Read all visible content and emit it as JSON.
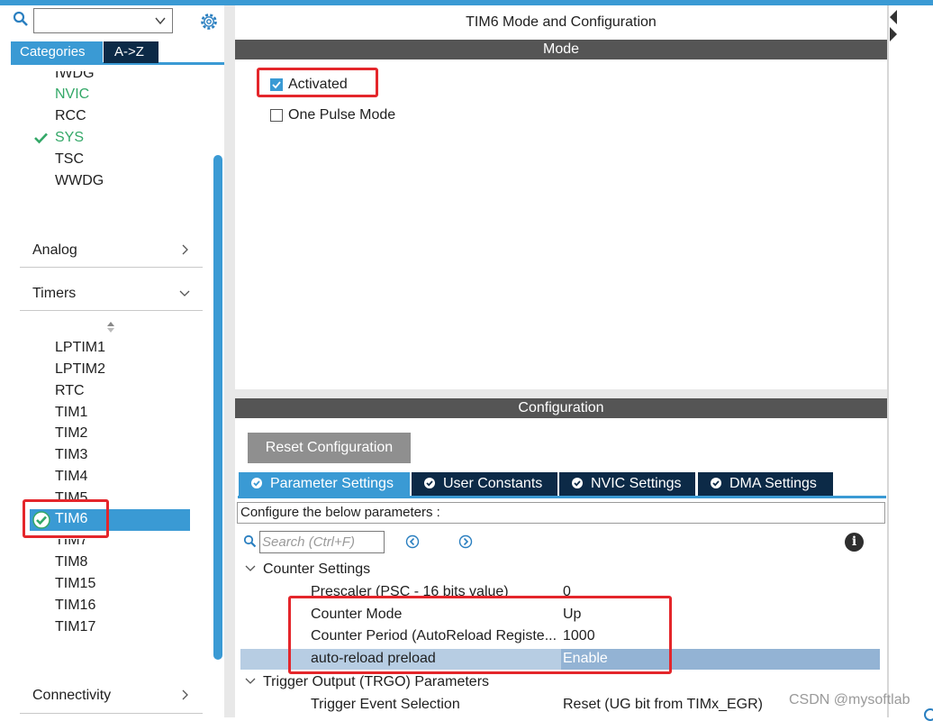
{
  "sidebar": {
    "search": {
      "value": ""
    },
    "tabs": [
      {
        "label": "Categories"
      },
      {
        "label": "A->Z"
      }
    ],
    "system_items": [
      "IWDG",
      "NVIC",
      "RCC",
      "SYS",
      "TSC",
      "WWDG"
    ],
    "groups": {
      "analog": "Analog",
      "timers": "Timers",
      "connectivity": "Connectivity"
    },
    "timer_items": [
      "LPTIM1",
      "LPTIM2",
      "RTC",
      "TIM1",
      "TIM2",
      "TIM3",
      "TIM4",
      "TIM5",
      "TIM6",
      "TIM7",
      "TIM8",
      "TIM15",
      "TIM16",
      "TIM17"
    ],
    "selected_item": "TIM6"
  },
  "main": {
    "title": "TIM6 Mode and Configuration",
    "mode_header": "Mode",
    "activated_label": "Activated",
    "activated_checked": true,
    "one_pulse_label": "One Pulse Mode",
    "one_pulse_checked": false,
    "config_header": "Configuration",
    "reset_button": "Reset Configuration",
    "tabs": [
      {
        "label": "Parameter Settings",
        "active": true
      },
      {
        "label": "User Constants",
        "active": false
      },
      {
        "label": "NVIC Settings",
        "active": false
      },
      {
        "label": "DMA Settings",
        "active": false
      }
    ],
    "configure_text": "Configure the below parameters :",
    "search_placeholder": "Search (Ctrl+F)",
    "groups": {
      "counter": "Counter Settings",
      "trigger": "Trigger Output (TRGO) Parameters"
    },
    "params": [
      {
        "name": "Prescaler (PSC - 16 bits value)",
        "value": "0"
      },
      {
        "name": "Counter Mode",
        "value": "Up"
      },
      {
        "name": "Counter Period (AutoReload Registe...",
        "value": "1000"
      },
      {
        "name": "auto-reload preload",
        "value": "Enable"
      },
      {
        "name": "Trigger Event Selection",
        "value": "Reset (UG bit from TIMx_EGR)"
      }
    ]
  },
  "watermark": "CSDN @mysoftlab",
  "colors": {
    "accent": "#3a9ad4",
    "dark_tab": "#0c2a47",
    "header_bar": "#555555",
    "highlight": "#e4262b",
    "green": "#34a868"
  }
}
